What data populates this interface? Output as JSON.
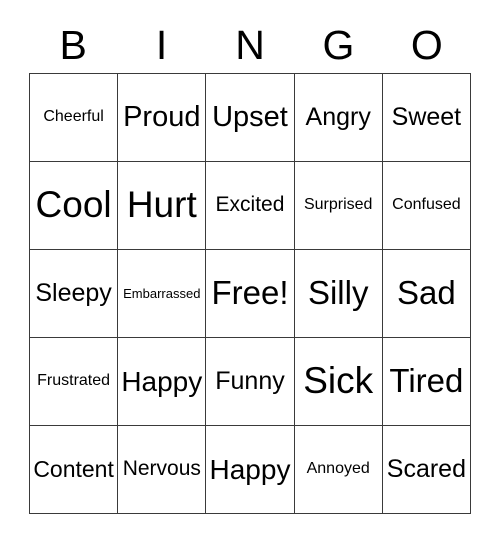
{
  "card": {
    "header_letters": [
      "B",
      "I",
      "N",
      "G",
      "O"
    ],
    "grid": {
      "rows": [
        [
          {
            "label": "Cheerful",
            "size": "s"
          },
          {
            "label": "Proud",
            "size": "xl"
          },
          {
            "label": "Upset",
            "size": "xl"
          },
          {
            "label": "Angry",
            "size": "l"
          },
          {
            "label": "Sweet",
            "size": "l"
          }
        ],
        [
          {
            "label": "Cool",
            "size": "xxxl"
          },
          {
            "label": "Hurt",
            "size": "xxxl"
          },
          {
            "label": "Excited",
            "size": "m"
          },
          {
            "label": "Surprised",
            "size": "s"
          },
          {
            "label": "Confused",
            "size": "s"
          }
        ],
        [
          {
            "label": "Sleepy",
            "size": "l"
          },
          {
            "label": "Embarrassed",
            "size": "xs"
          },
          {
            "label": "Free!",
            "size": "xxl"
          },
          {
            "label": "Silly",
            "size": "xxl"
          },
          {
            "label": "Sad",
            "size": "xxl"
          }
        ],
        [
          {
            "label": "Frustrated",
            "size": "s"
          },
          {
            "label": "Happy",
            "size": "xl"
          },
          {
            "label": "Funny",
            "size": "l"
          },
          {
            "label": "Sick",
            "size": "xxxl"
          },
          {
            "label": "Tired",
            "size": "xxl"
          }
        ],
        [
          {
            "label": "Content",
            "size": "l"
          },
          {
            "label": "Nervous",
            "size": "m"
          },
          {
            "label": "Happy",
            "size": "xl"
          },
          {
            "label": "Annoyed",
            "size": "s"
          },
          {
            "label": "Scared",
            "size": "l"
          }
        ]
      ]
    },
    "free_space": {
      "row": 2,
      "col": 2,
      "label": "Free!"
    },
    "colors": {
      "background": "#ffffff",
      "text": "#000000",
      "grid_line": "#3a3a3a"
    }
  }
}
